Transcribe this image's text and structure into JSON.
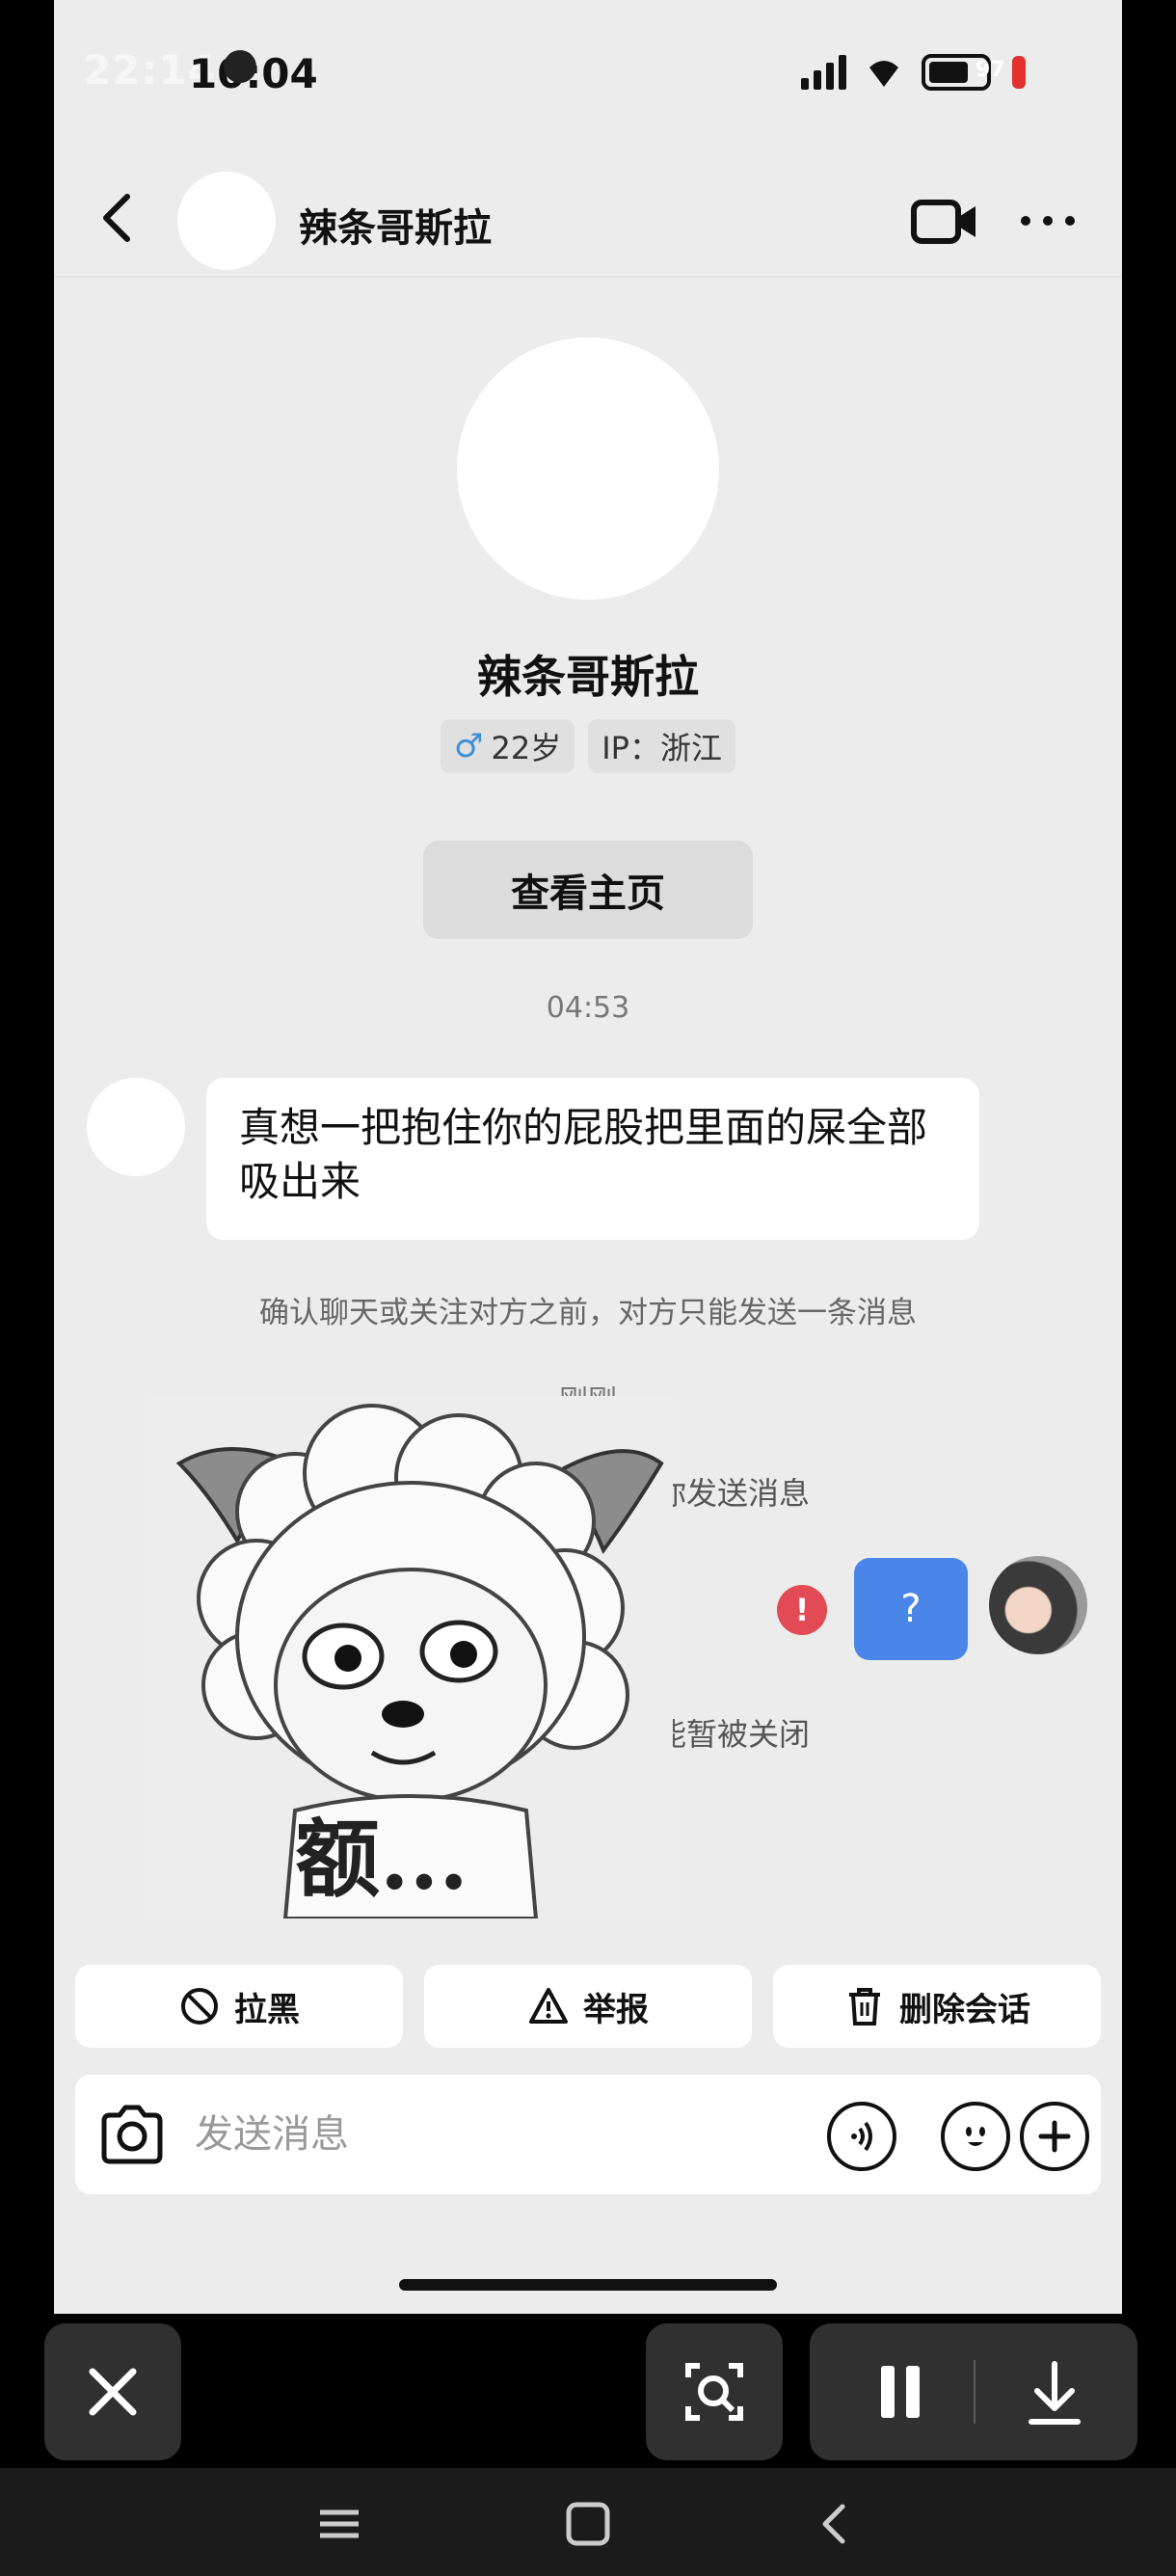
{
  "status_bar": {
    "ghost_time": "22:14",
    "time": "10:04",
    "battery": "97"
  },
  "header": {
    "title": "辣条哥斯拉"
  },
  "profile": {
    "name": "辣条哥斯拉",
    "gender_symbol": "♂",
    "age": "22岁",
    "ip": "IP：浙江",
    "home_button": "查看主页"
  },
  "messages": {
    "timestamp_1": "04:53",
    "incoming_text": "真想一把抱住你的屁股把里面的屎全部吸出来",
    "notice_1": "确认聊天或关注对方之前，对方只能发送一条消息",
    "timestamp_2": "刚刚",
    "notice_2": "俟向你发送消息",
    "outgoing_text": "?",
    "error_symbol": "!",
    "notice_3": "青功能暂被关闭"
  },
  "sticker": {
    "caption": "额..."
  },
  "actions": {
    "block": "拉黑",
    "report": "举报",
    "delete": "删除会话"
  },
  "input_bar": {
    "placeholder": "发送消息"
  },
  "colors": {
    "accent_blue": "#4a86e8",
    "error_red": "#e24a55",
    "background": "#ececec"
  },
  "icons": [
    "back-icon",
    "video-icon",
    "more-icon",
    "camera-icon",
    "voice-icon",
    "emoji-icon",
    "plus-icon",
    "block-icon",
    "warning-icon",
    "trash-icon"
  ]
}
